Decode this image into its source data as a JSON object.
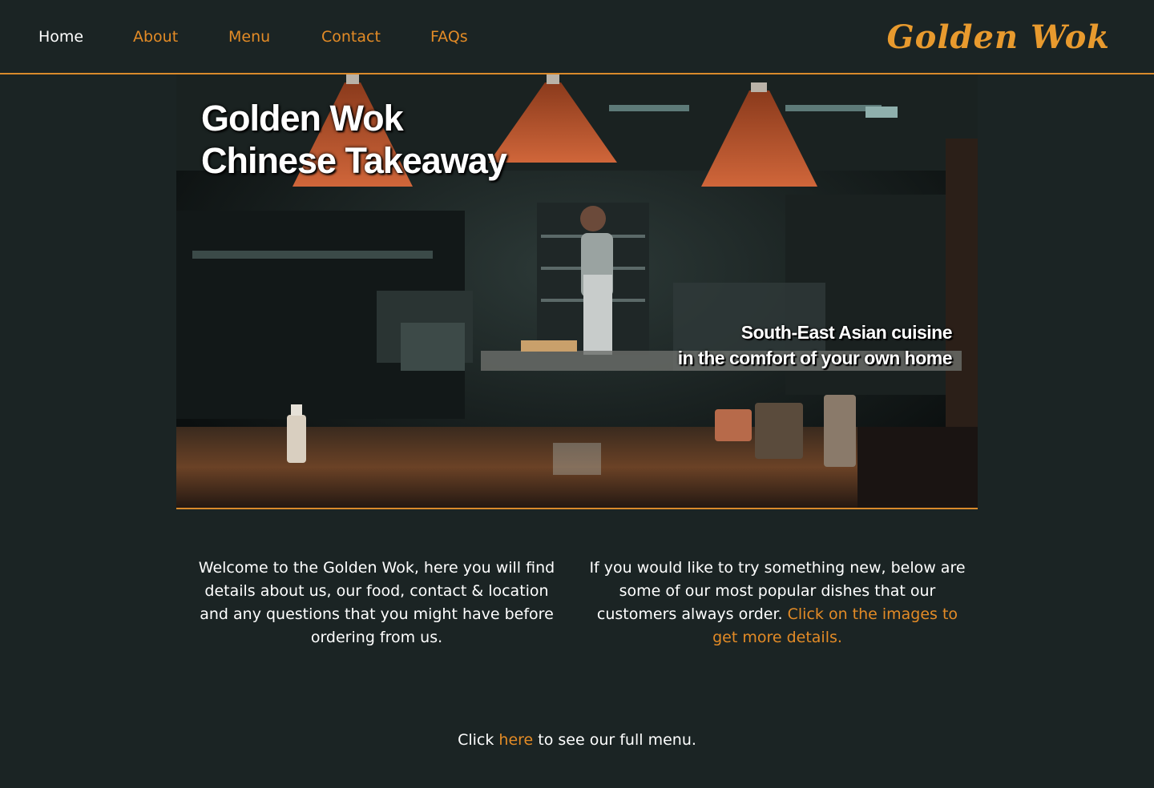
{
  "nav": {
    "items": [
      {
        "label": "Home",
        "active": true
      },
      {
        "label": "About",
        "active": false
      },
      {
        "label": "Menu",
        "active": false
      },
      {
        "label": "Contact",
        "active": false
      },
      {
        "label": "FAQs",
        "active": false
      }
    ],
    "brand": "Golden Wok"
  },
  "hero": {
    "title_line1": "Golden Wok",
    "title_line2": "Chinese Takeaway",
    "tagline_line1": "South-East Asian cuisine",
    "tagline_line2": "in the comfort of your own home"
  },
  "intro": {
    "left_text": "Welcome to the Golden Wok, here you will find details about us, our food, contact & location and any questions that you might have before ordering from us.",
    "right_text": "If you would like to try something new, below are some of our most popular dishes that our customers always order.",
    "right_link": "Click on the images to get more details."
  },
  "cta": {
    "prefix": "Click",
    "link": "here",
    "suffix": "to see our full menu."
  },
  "colors": {
    "background": "#1b2424",
    "accent": "#e38b26",
    "text": "#ffffff"
  }
}
